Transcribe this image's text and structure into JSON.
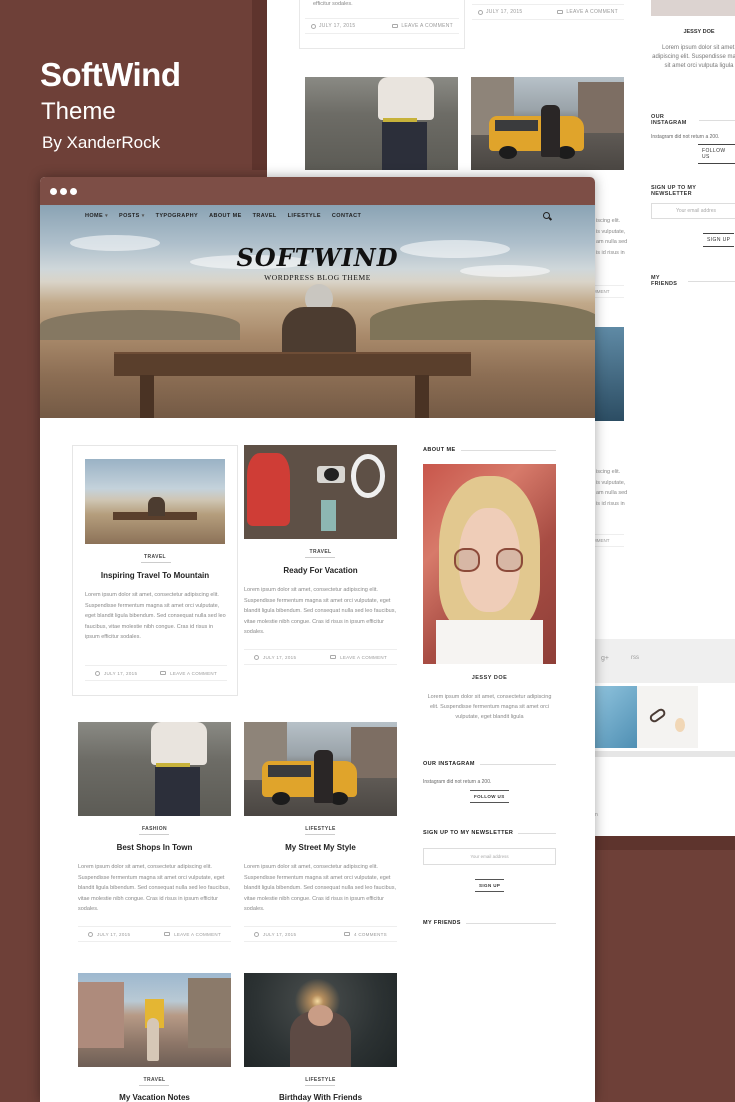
{
  "promo": {
    "title": "SoftWind",
    "subtitle": "Theme",
    "author": "By XanderRock"
  },
  "background_page": {
    "top_excerpt": "efficitur sodales.",
    "meta_left": {
      "date": "JULY 17, 2015",
      "comment": "LEAVE A COMMENT"
    },
    "meta_right": {
      "date": "JULY 17, 2015",
      "comment": "LEAVE A COMMENT"
    },
    "snippets": [
      "iscing elit.",
      "is vulputate,",
      "am nulla sed",
      "is id risus in",
      "MMENT",
      "iscing elit.",
      "is vulputate,",
      "am nulla sed",
      "is id risus in",
      "MMENT"
    ],
    "sidebar": {
      "name": "JESSY DOE",
      "bio": "Lorem ipsum dolor sit amet, adipiscing elit. Suspendisse magna sit amet orci vulputa ligula",
      "instagram_heading": "OUR INSTAGRAM",
      "instagram_text": "Instagram did not return a 200.",
      "follow_label": "FOLLOW US",
      "newsletter_heading": "SIGN UP TO MY NEWSLETTER",
      "email_placeholder": "Your email addres",
      "signup_label": "SIGN UP",
      "friends_heading": "MY FRIENDS"
    },
    "footer_symbols": [
      "g+",
      "rss"
    ],
    "footer_fragment": "n"
  },
  "window": {
    "nav": [
      {
        "label": "HOME",
        "caret": true
      },
      {
        "label": "POSTS",
        "caret": true
      },
      {
        "label": "TYPOGRAPHY",
        "caret": false
      },
      {
        "label": "ABOUT ME",
        "caret": false
      },
      {
        "label": "TRAVEL",
        "caret": false
      },
      {
        "label": "LIFESTYLE",
        "caret": false
      },
      {
        "label": "CONTACT",
        "caret": false
      }
    ],
    "logo": "SOFTWIND",
    "tagline": "WORDPRESS BLOG THEME",
    "posts": [
      {
        "category": "TRAVEL",
        "title": "Inspiring Travel To Mountain",
        "excerpt": "Lorem ipsum dolor sit amet, consectetur adipiscing elit. Suspendisse fermentum magna sit amet orci vulputate, eget blandit ligula bibendum. Sed consequat nulla sed leo faucibus, vitae molestie nibh congue. Cras id risus in ipsum efficitur sodales.",
        "date": "JULY 17, 2015",
        "comment": "LEAVE A COMMENT"
      },
      {
        "category": "TRAVEL",
        "title": "Ready For Vacation",
        "excerpt": "Lorem ipsum dolor sit amet, consectetur adipiscing elit. Suspendisse fermentum magna sit amet orci vulputate, eget blandit ligula bibendum. Sed consequat nulla sed leo faucibus, vitae molestie nibh congue. Cras id risus in ipsum efficitur sodales.",
        "date": "JULY 17, 2015",
        "comment": "LEAVE A COMMENT"
      },
      {
        "category": "FASHION",
        "title": "Best Shops In Town",
        "excerpt": "Lorem ipsum dolor sit amet, consectetur adipiscing elit. Suspendisse fermentum magna sit amet orci vulputate, eget blandit ligula bibendum. Sed consequat nulla sed leo faucibus, vitae molestie nibh congue. Cras id risus in ipsum efficitur sodales.",
        "date": "JULY 17, 2015",
        "comment": "LEAVE A COMMENT"
      },
      {
        "category": "LIFESTYLE",
        "title": "My Street My Style",
        "excerpt": "Lorem ipsum dolor sit amet, consectetur adipiscing elit. Suspendisse fermentum magna sit amet orci vulputate, eget blandit ligula bibendum. Sed consequat nulla sed leo faucibus, vitae molestie nibh congue. Cras id risus in ipsum efficitur sodales.",
        "date": "JULY 17, 2015",
        "comment": "4 COMMENTS"
      },
      {
        "category": "TRAVEL",
        "title": "My Vacation Notes"
      },
      {
        "category": "LIFESTYLE",
        "title": "Birthday With Friends"
      }
    ],
    "sidebar": {
      "about_heading": "ABOUT ME",
      "name": "JESSY DOE",
      "bio": "Lorem ipsum dolor sit amet, consectetur adipiscing elit. Suspendisse fermentum magna sit amet orci vulputate, eget blandit ligula",
      "instagram_heading": "OUR INSTAGRAM",
      "instagram_text": "Instagram did not return a 200.",
      "follow_label": "FOLLOW US",
      "newsletter_heading": "SIGN UP TO MY NEWSLETTER",
      "email_placeholder": "Your email address",
      "signup_label": "SIGN UP",
      "friends_heading": "MY FRIENDS"
    }
  },
  "colors": {
    "brand_brown": "#6e4038",
    "titlebar": "#7d4e46",
    "text_dark": "#222222",
    "text_muted": "#888888"
  }
}
